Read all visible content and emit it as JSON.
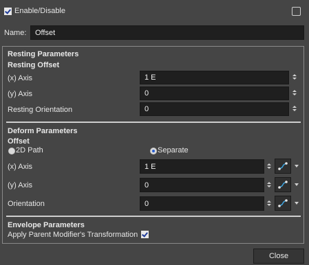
{
  "header": {
    "enable_label": "Enable/Disable",
    "enable_checked": true
  },
  "name": {
    "label": "Name:",
    "value": "Offset"
  },
  "resting": {
    "title": "Resting Parameters",
    "subtitle": "Resting Offset",
    "x_label": "(x) Axis",
    "x_value": "1 E",
    "y_label": "(y) Axis",
    "y_value": "0",
    "orient_label": "Resting Orientation",
    "orient_value": "0"
  },
  "deform": {
    "title": "Deform Parameters",
    "subtitle": "Offset",
    "mode_2d_label": "2D Path",
    "mode_separate_label": "Separate",
    "selected_mode": "Separate",
    "x_label": "(x) Axis",
    "x_value": "1 E",
    "y_label": "(y) Axis",
    "y_value": "0",
    "orient_label": "Orientation",
    "orient_value": "0"
  },
  "envelope": {
    "title": "Envelope Parameters",
    "apply_label": "Apply Parent Modifier's Transformation",
    "apply_checked": true
  },
  "footer": {
    "close_label": "Close"
  },
  "colors": {
    "background": "#454545",
    "field": "#1f1f1f",
    "accent": "#3da5e0"
  }
}
